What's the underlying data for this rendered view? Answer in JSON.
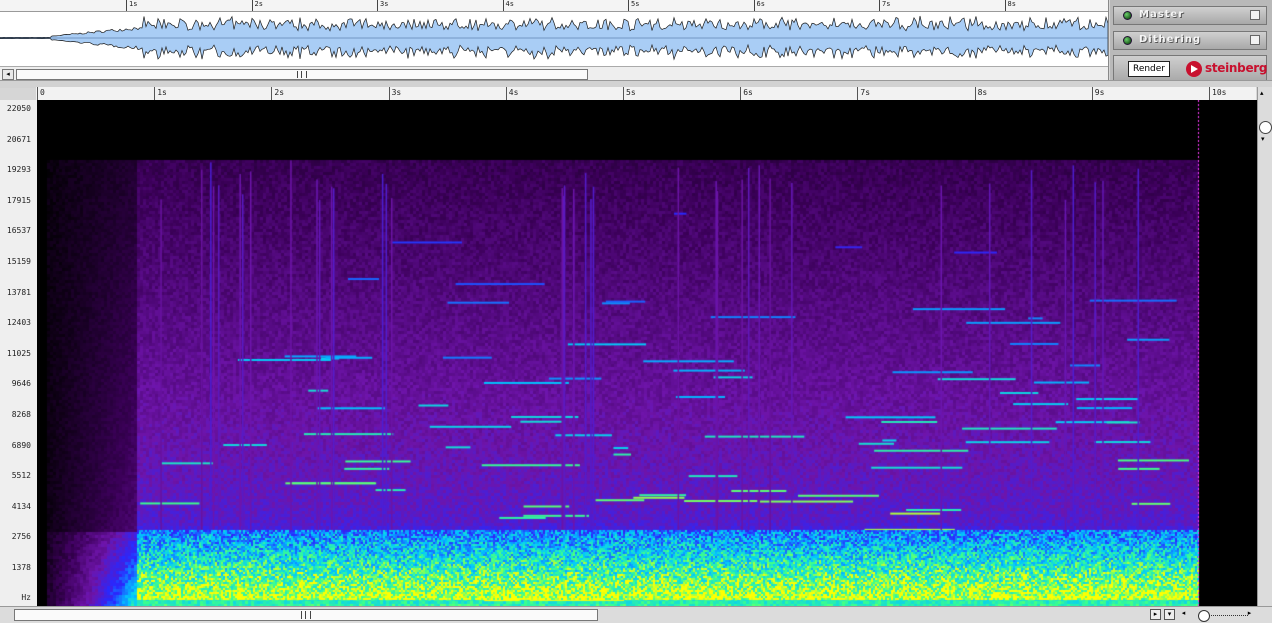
{
  "overview": {
    "ruler_labels": [
      "1s",
      "2s",
      "3s",
      "4s",
      "5s",
      "6s",
      "7s",
      "8s"
    ]
  },
  "panel": {
    "master_label": "Master",
    "dithering_label": "Dithering",
    "render_label": "Render",
    "brand": "steinberg"
  },
  "time_ruler": {
    "labels": [
      "0",
      "1s",
      "2s",
      "3s",
      "4s",
      "5s",
      "6s",
      "7s",
      "8s",
      "9s",
      "10s"
    ]
  },
  "frequency_axis": {
    "labels": [
      "22050",
      "20671",
      "19293",
      "17915",
      "16537",
      "15159",
      "13781",
      "12403",
      "11025",
      "9646",
      "8268",
      "6890",
      "5512",
      "4134",
      "2756",
      "1378",
      "Hz"
    ]
  },
  "colors": {
    "waveform_fill": "#a9cdf5",
    "spectrogram_bg": "#000000",
    "playhead": "#ff3cff",
    "brand_red": "#c8102e"
  },
  "icons": {
    "left_arrow": "◂",
    "right_arrow": "▸",
    "up_arrow": "▴",
    "down_arrow": "▾"
  }
}
